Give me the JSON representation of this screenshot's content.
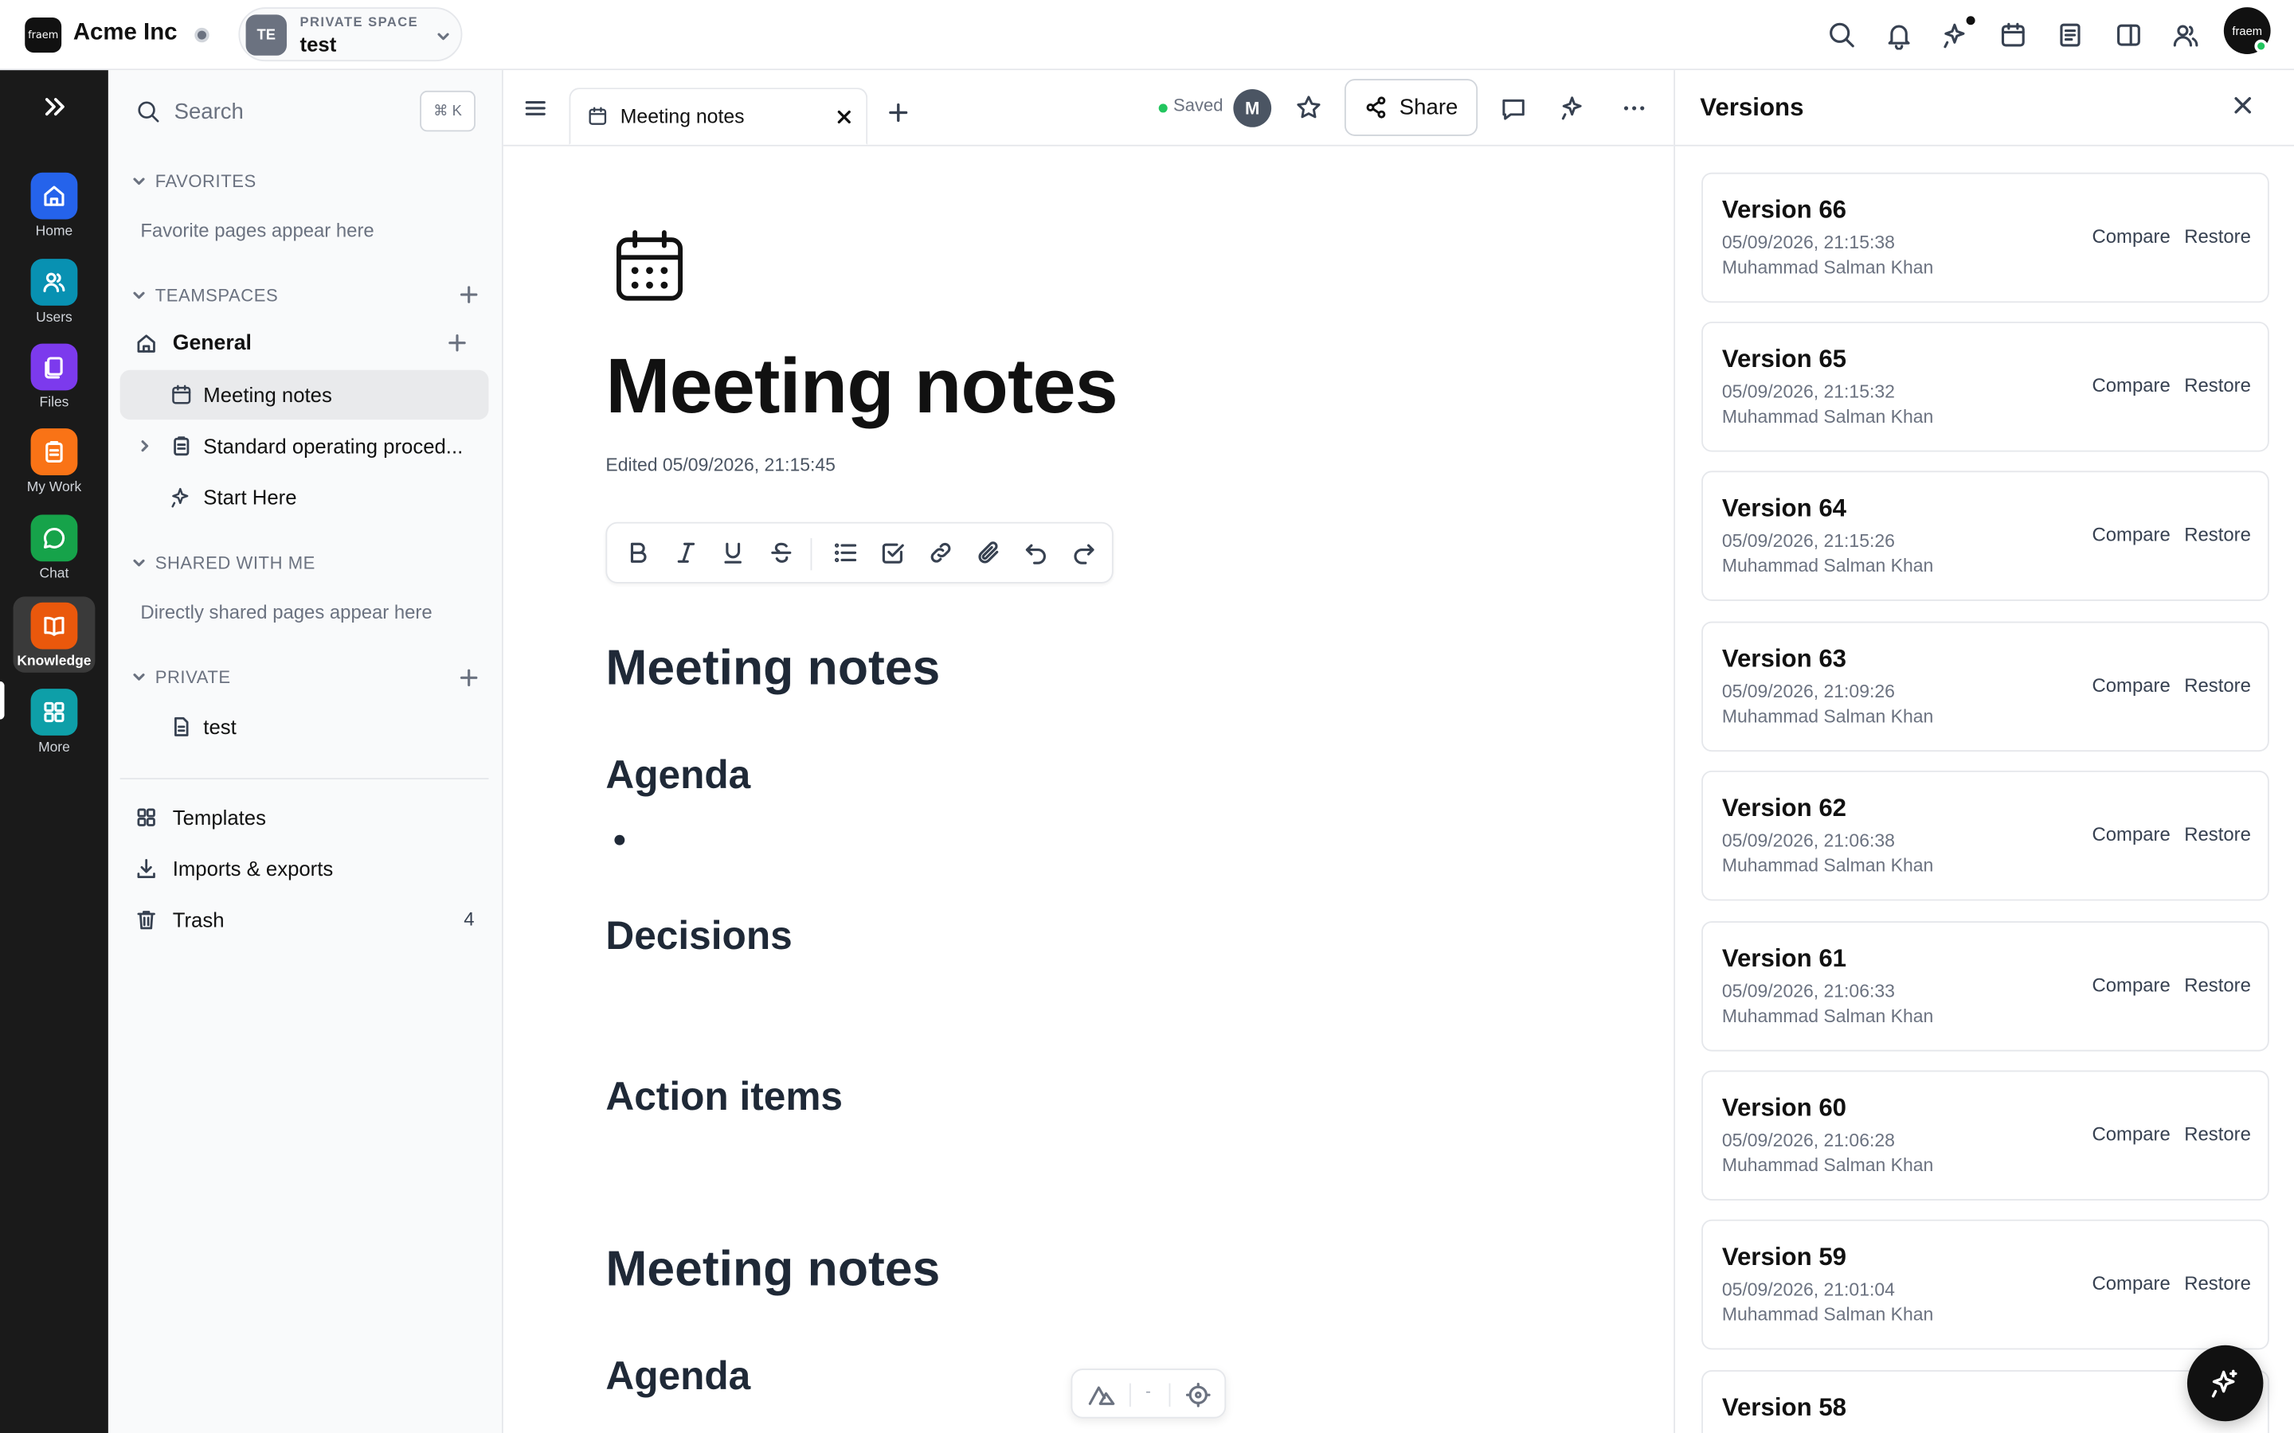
{
  "topbar": {
    "logo_text": "fraem",
    "org_name": "Acme Inc",
    "space_avatar": "TE",
    "space_label": "PRIVATE SPACE",
    "space_name": "test",
    "avatar_text": "fraem",
    "icons": [
      "search-icon",
      "bell-icon",
      "ai-sparkle-icon",
      "calendar-icon",
      "notebook-icon",
      "split-panel-icon",
      "people-icon"
    ]
  },
  "rail": {
    "items": [
      {
        "label": "Home",
        "color": "#2563eb",
        "icon": "home-icon"
      },
      {
        "label": "Users",
        "color": "#0891b2",
        "icon": "users-icon"
      },
      {
        "label": "Files",
        "color": "#7c3aed",
        "icon": "files-icon"
      },
      {
        "label": "My Work",
        "color": "#f97316",
        "icon": "clipboard-icon"
      },
      {
        "label": "Chat",
        "color": "#16a34a",
        "icon": "chat-icon"
      },
      {
        "label": "Knowledge",
        "color": "#ea580c",
        "icon": "book-icon"
      },
      {
        "label": "More",
        "color": "#0e9fa8",
        "icon": "grid-icon"
      }
    ]
  },
  "sidebar": {
    "search_placeholder": "Search",
    "shortcut": "⌘ K",
    "favorites_header": "FAVORITES",
    "favorites_empty": "Favorite pages appear here",
    "teamspaces_header": "TEAMSPACES",
    "team_general": "General",
    "pages": [
      "Meeting notes",
      "Standard operating proced...",
      "Start Here"
    ],
    "shared_header": "SHARED WITH ME",
    "shared_empty": "Directly shared pages appear here",
    "private_header": "PRIVATE",
    "private_pages": [
      "test"
    ],
    "templates": "Templates",
    "imports": "Imports & exports",
    "trash": "Trash",
    "trash_count": "4"
  },
  "main": {
    "tab_label": "Meeting notes",
    "saved": "Saved",
    "collab_avatar": "M",
    "share": "Share",
    "title": "Meeting notes",
    "edited": "Edited 05/09/2026, 21:15:45",
    "blocks": {
      "h1a": "Meeting notes",
      "agenda1": "Agenda",
      "decisions": "Decisions",
      "actions": "Action items",
      "h1b": "Meeting notes",
      "agenda2": "Agenda"
    }
  },
  "versions": {
    "title": "Versions",
    "compare": "Compare",
    "restore": "Restore",
    "items": [
      {
        "name": "Version 66",
        "date": "05/09/2026, 21:15:38",
        "user": "Muhammad Salman Khan"
      },
      {
        "name": "Version 65",
        "date": "05/09/2026, 21:15:32",
        "user": "Muhammad Salman Khan"
      },
      {
        "name": "Version 64",
        "date": "05/09/2026, 21:15:26",
        "user": "Muhammad Salman Khan"
      },
      {
        "name": "Version 63",
        "date": "05/09/2026, 21:09:26",
        "user": "Muhammad Salman Khan"
      },
      {
        "name": "Version 62",
        "date": "05/09/2026, 21:06:38",
        "user": "Muhammad Salman Khan"
      },
      {
        "name": "Version 61",
        "date": "05/09/2026, 21:06:33",
        "user": "Muhammad Salman Khan"
      },
      {
        "name": "Version 60",
        "date": "05/09/2026, 21:06:28",
        "user": "Muhammad Salman Khan"
      },
      {
        "name": "Version 59",
        "date": "05/09/2026, 21:01:04",
        "user": "Muhammad Salman Khan"
      },
      {
        "name": "Version 58",
        "date": "",
        "user": ""
      }
    ]
  }
}
